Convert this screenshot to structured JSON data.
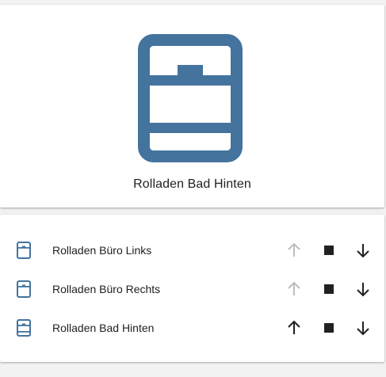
{
  "colors": {
    "icon_blue": "#44739e",
    "text": "#212121",
    "disabled": "#bdbdbd",
    "active": "#212121"
  },
  "hero": {
    "icon": "window-shutter-icon",
    "title": "Rolladen Bad Hinten"
  },
  "covers": [
    {
      "name": "Rolladen Büro Links",
      "icon": "window-shutter-icon",
      "up_enabled": false
    },
    {
      "name": "Rolladen Büro Rechts",
      "icon": "window-shutter-icon",
      "up_enabled": false
    },
    {
      "name": "Rolladen Bad Hinten",
      "icon": "window-shutter-icon",
      "up_enabled": true
    }
  ],
  "controls": {
    "up_icon": "arrow-up-icon",
    "stop_icon": "stop-icon",
    "down_icon": "arrow-down-icon"
  }
}
